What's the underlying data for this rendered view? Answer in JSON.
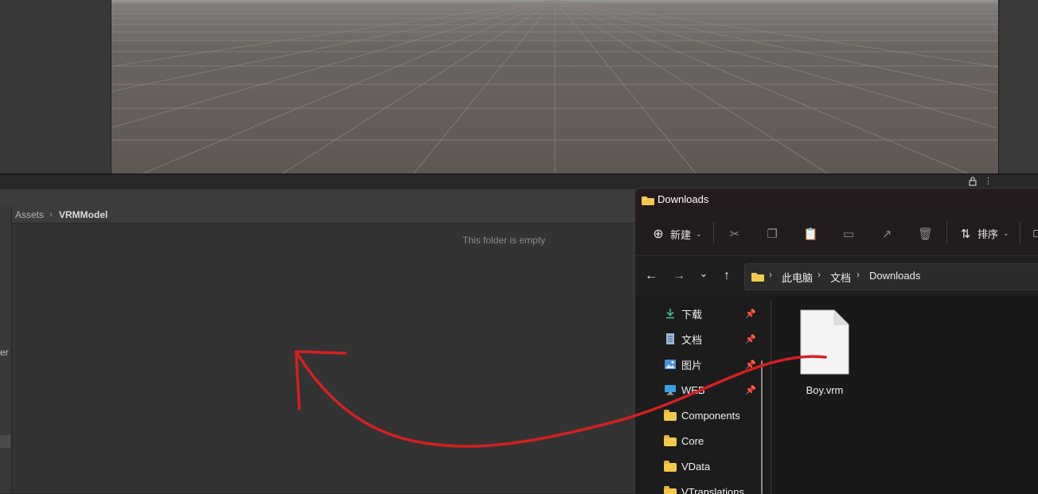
{
  "unity": {
    "breadcrumb": [
      "Assets",
      "VRMModel"
    ],
    "empty_message": "This folder is empty",
    "left_pane_partial_text": "er"
  },
  "explorer": {
    "title": "Downloads",
    "commandbar": {
      "new_label": "新建",
      "sort_label": "排序",
      "icons": [
        "cut-icon",
        "copy-icon",
        "paste-icon",
        "rename-icon",
        "share-icon",
        "delete-icon"
      ]
    },
    "address": [
      "此电脑",
      "文档",
      "Downloads"
    ],
    "sidebar": {
      "items": [
        {
          "label": "下载",
          "icon": "download-icon",
          "pinned": true
        },
        {
          "label": "文档",
          "icon": "document-icon",
          "pinned": true
        },
        {
          "label": "图片",
          "icon": "pictures-icon",
          "pinned": true
        },
        {
          "label": "WEB",
          "icon": "monitor-icon",
          "pinned": true
        },
        {
          "label": "Components",
          "icon": "folder-icon",
          "pinned": false
        },
        {
          "label": "Core",
          "icon": "folder-icon",
          "pinned": false
        },
        {
          "label": "VData",
          "icon": "folder-icon",
          "pinned": false
        },
        {
          "label": "VTranslations",
          "icon": "folder-icon",
          "pinned": false
        }
      ]
    },
    "files": [
      {
        "name": "Boy.vrm",
        "icon": "blank-file-icon"
      }
    ]
  },
  "colors": {
    "annotation_arrow": "#d42020",
    "folder_yellow": "#f2c94c",
    "unity_panel": "#333333",
    "explorer_bg": "#1c1c1c"
  }
}
